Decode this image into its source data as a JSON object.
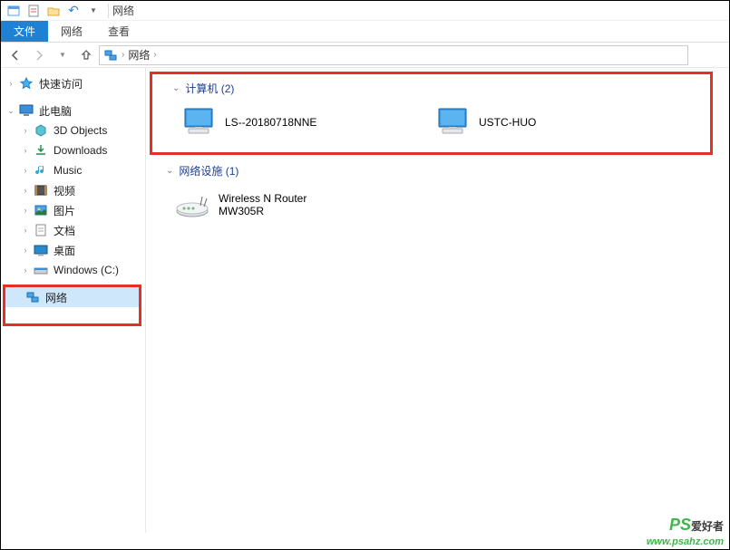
{
  "titlebar": {
    "title": "网络"
  },
  "ribbon": {
    "file": "文件",
    "tab_network": "网络",
    "tab_view": "查看"
  },
  "address": {
    "root": "网络"
  },
  "sidebar": {
    "quick": "快速访问",
    "pc": "此电脑",
    "items": [
      "3D Objects",
      "Downloads",
      "Music",
      "视频",
      "图片",
      "文档",
      "桌面",
      "Windows (C:)"
    ],
    "network": "网络"
  },
  "content": {
    "group1": {
      "label": "计算机 (2)",
      "items": [
        "LS--20180718NNE",
        "USTC-HUO"
      ]
    },
    "group2": {
      "label": "网络设施 (1)",
      "item_line1": "Wireless N Router",
      "item_line2": "MW305R"
    }
  },
  "watermark": {
    "brand": "PS",
    "cn": "爱好者",
    "url": "www.psahz.com"
  }
}
